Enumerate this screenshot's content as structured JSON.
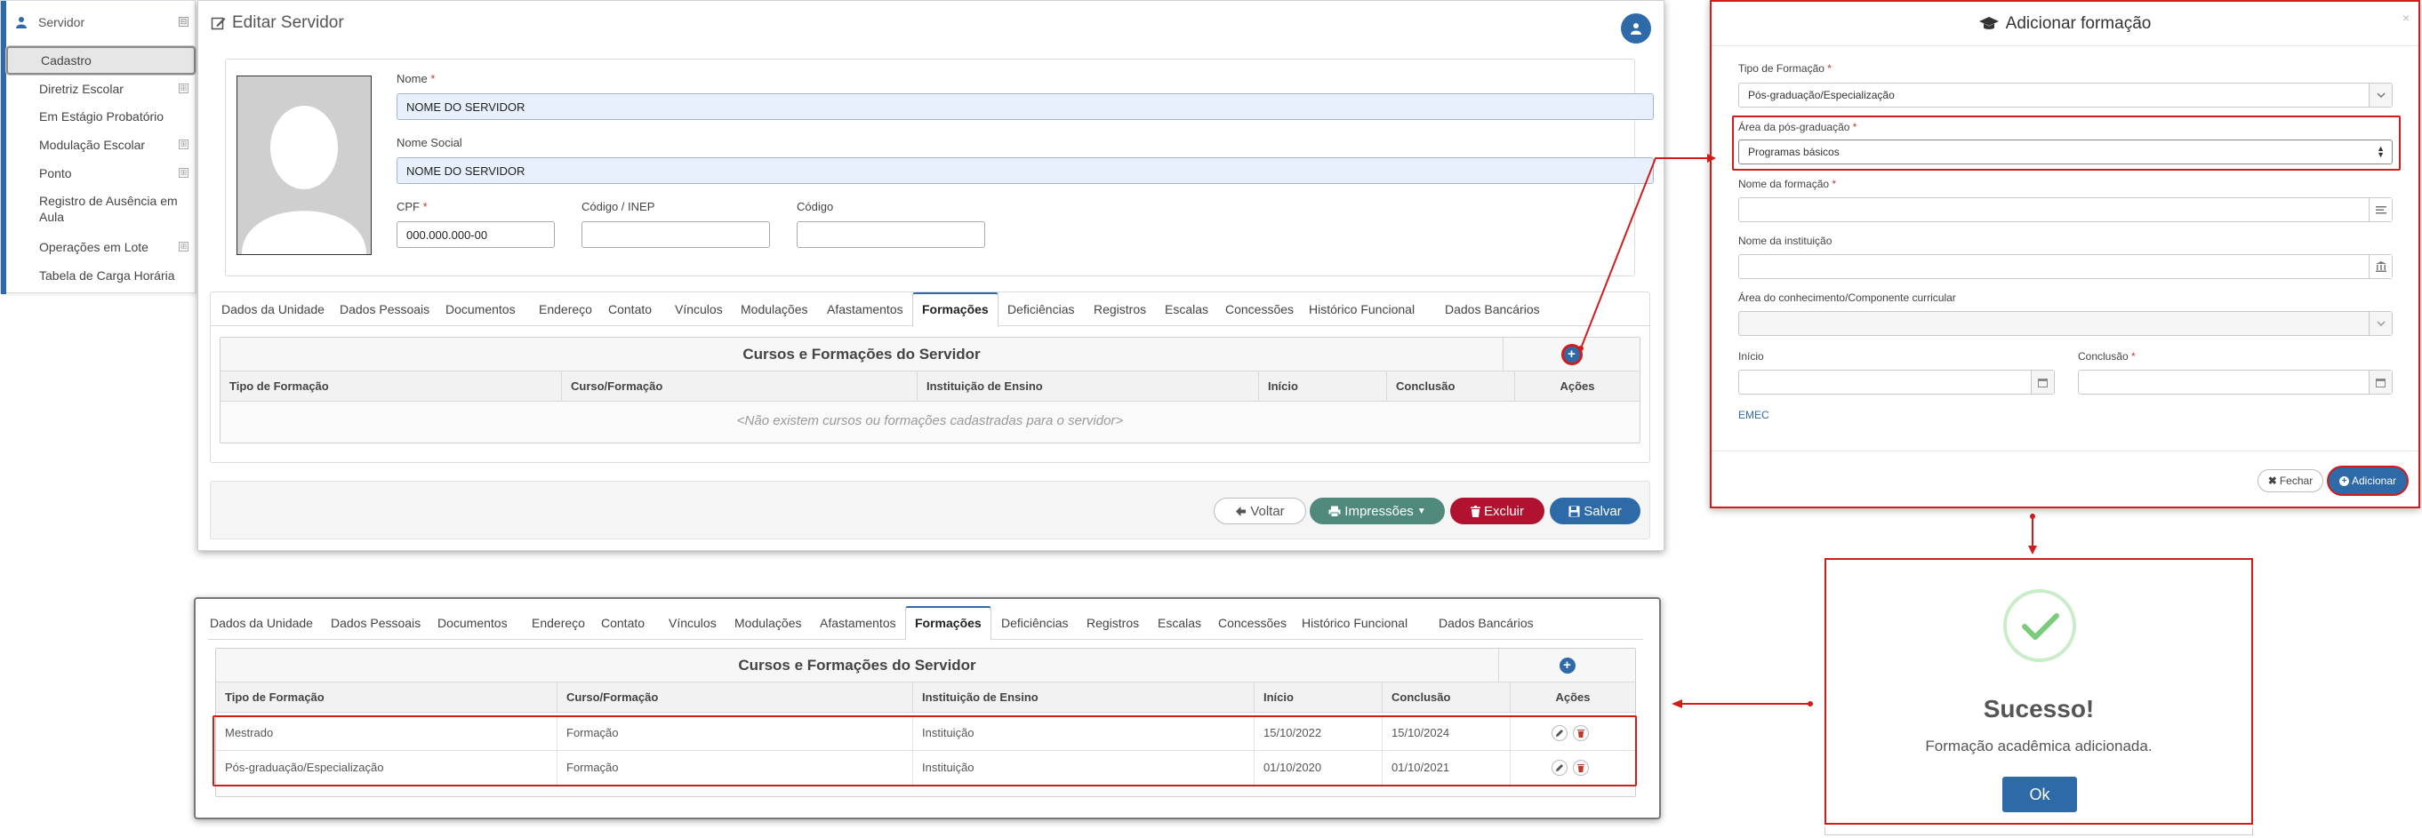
{
  "sidebar": {
    "title": "Servidor",
    "collapse": "⊟",
    "expand": "⊞",
    "items": [
      {
        "label": "Cadastro"
      },
      {
        "label": "Diretriz Escolar"
      },
      {
        "label": "Em Estágio Probatório"
      },
      {
        "label": "Modulação Escolar"
      },
      {
        "label": "Ponto"
      },
      {
        "label": "Registro de Ausência em Aula"
      },
      {
        "label": "Operações em Lote"
      },
      {
        "label": "Tabela de Carga Horária"
      }
    ]
  },
  "page": {
    "title": "Editar Servidor"
  },
  "form": {
    "nome_label": "Nome",
    "nome_value": "NOME DO SERVIDOR",
    "nome_social_label": "Nome Social",
    "nome_social_value": "NOME DO SERVIDOR",
    "cpf_label": "CPF",
    "cpf_value": "000.000.000-00",
    "inep_label": "Código / INEP",
    "codigo_label": "Código",
    "required_mark": "*"
  },
  "tabs": [
    "Dados da Unidade",
    "Dados Pessoais",
    "Documentos",
    "Endereço",
    "Contato",
    "Vínculos",
    "Modulações",
    "Afastamentos",
    "Formações",
    "Deficiências",
    "Registros",
    "Escalas",
    "Concessões",
    "Histórico Funcional",
    "Dados Bancários"
  ],
  "grid": {
    "title": "Cursos e Formações do Servidor",
    "columns": [
      "Tipo de Formação",
      "Curso/Formação",
      "Instituição de Ensino",
      "Início",
      "Conclusão",
      "Ações"
    ],
    "empty": "<Não existem cursos ou formações cadastradas para o servidor>",
    "plus": "+",
    "rows": [
      {
        "tipo": "Mestrado",
        "curso": "Formação",
        "instituicao": "Instituição",
        "inicio": "15/10/2022",
        "conclusao": "15/10/2024"
      },
      {
        "tipo": "Pós-graduação/Especialização",
        "curso": "Formação",
        "instituicao": "Instituição",
        "inicio": "01/10/2020",
        "conclusao": "01/10/2021"
      }
    ]
  },
  "actions": {
    "voltar": "Voltar",
    "impressoes": "Impressões",
    "excluir": "Excluir",
    "salvar": "Salvar"
  },
  "modal": {
    "title": "Adicionar formação",
    "close": "×",
    "tipo_label": "Tipo de Formação",
    "tipo_value": "Pós-graduação/Especialização",
    "area_pos_label": "Área da pós-graduação",
    "area_pos_value": "Programas básicos",
    "nome_formacao_label": "Nome da formação",
    "nome_instituicao_label": "Nome da instituição",
    "area_conhecimento_label": "Área do conhecimento/Componente curricular",
    "inicio_label": "Início",
    "conclusao_label": "Conclusão",
    "emec_link": "EMEC",
    "fechar": "Fechar",
    "adicionar": "Adicionar",
    "required_mark": "*"
  },
  "success": {
    "title": "Sucesso!",
    "message": "Formação acadêmica adicionada.",
    "ok": "Ok"
  },
  "colors": {
    "primary": "#2e6aa8",
    "teal": "#4f8a7d",
    "danger": "#b0122f",
    "highlight": "#d31b1b"
  }
}
